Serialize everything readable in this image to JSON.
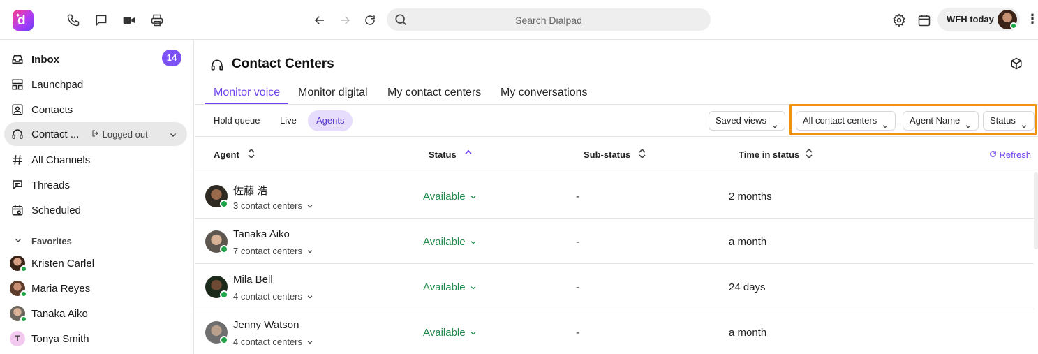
{
  "topbar": {
    "search_placeholder": "Search Dialpad",
    "status_label": "WFH today",
    "icons": [
      "dialpad-logo",
      "phone-icon",
      "message-icon",
      "video-icon",
      "printer-icon",
      "back-arrow-icon",
      "forward-arrow-icon",
      "reload-icon",
      "search-icon",
      "gear-icon",
      "calendar-icon",
      "more-vertical-icon"
    ]
  },
  "sidebar": {
    "items": [
      {
        "label": "Inbox",
        "icon": "inbox-icon",
        "badge": "14"
      },
      {
        "label": "Launchpad",
        "icon": "launchpad-icon"
      },
      {
        "label": "Contacts",
        "icon": "contacts-icon"
      },
      {
        "label": "Contact ...",
        "icon": "headphones-icon",
        "status": "Logged out"
      },
      {
        "label": "All Channels",
        "icon": "hash-icon"
      },
      {
        "label": "Threads",
        "icon": "threads-icon"
      },
      {
        "label": "Scheduled",
        "icon": "scheduled-icon"
      }
    ],
    "favorites_label": "Favorites",
    "favorites": [
      {
        "name": "Kristen Carlel",
        "online": true
      },
      {
        "name": "Maria Reyes",
        "online": true
      },
      {
        "name": "Tanaka Aiko",
        "online": true
      },
      {
        "name": "Tonya Smith",
        "initial": "T",
        "online": false
      }
    ]
  },
  "main": {
    "title": "Contact Centers",
    "tabs": [
      {
        "label": "Monitor voice",
        "active": true
      },
      {
        "label": "Monitor digital"
      },
      {
        "label": "My contact centers"
      },
      {
        "label": "My conversations"
      }
    ],
    "subtabs": [
      {
        "label": "Hold queue"
      },
      {
        "label": "Live"
      },
      {
        "label": "Agents",
        "active": true
      }
    ],
    "filters": {
      "saved_views": "Saved views",
      "contact_centers": "All contact centers",
      "agent_name": "Agent Name",
      "status": "Status"
    },
    "table": {
      "headers": {
        "agent": "Agent",
        "status": "Status",
        "sub_status": "Sub-status",
        "time_in_status": "Time in status"
      },
      "refresh_label": "Refresh",
      "rows": [
        {
          "name": "佐藤 浩",
          "contact_centers": "3 contact centers",
          "status": "Available",
          "sub_status": "-",
          "time": "2 months"
        },
        {
          "name": "Tanaka Aiko",
          "contact_centers": "7 contact centers",
          "status": "Available",
          "sub_status": "-",
          "time": "a month"
        },
        {
          "name": "Mila Bell",
          "contact_centers": "4 contact centers",
          "status": "Available",
          "sub_status": "-",
          "time": "24 days"
        },
        {
          "name": "Jenny Watson",
          "contact_centers": "4 contact centers",
          "status": "Available",
          "sub_status": "-",
          "time": "a month"
        }
      ]
    }
  },
  "colors": {
    "accent": "#6f42f0",
    "available": "#1f8a4b",
    "highlight": "#f0920f",
    "online": "#1ea446"
  }
}
